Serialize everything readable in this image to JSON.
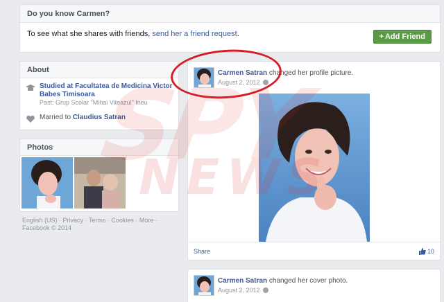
{
  "know_box": {
    "title": "Do you know Carmen?",
    "text": "To see what she shares with friends, ",
    "link": "send her a friend request",
    "text_end": ".",
    "button": "Add Friend",
    "button_icon": "+"
  },
  "about": {
    "title": "About",
    "education": "Studied at Facultatea de Medicina Victor Babes Timisoara",
    "past": "Past: Grup Scolar \"Mihai Viteazul\" Ineu",
    "married_prefix": "Married to ",
    "married_name": "Claudius Satran"
  },
  "photos": {
    "title": "Photos"
  },
  "footer": {
    "links": "English (US) · Privacy · Terms · Cookies · More ·",
    "copyright": "Facebook © 2014"
  },
  "post1": {
    "name": "Carmen Satran",
    "action": "changed her profile picture.",
    "date": "August 2, 2012",
    "share": "Share",
    "likes": "10"
  },
  "post2": {
    "name": "Carmen Satran",
    "action": "changed her cover photo.",
    "date": "August 2, 2012"
  },
  "watermark": {
    "line1": "SPY",
    "line2": "NEWS"
  },
  "colors": {
    "brand": "#3b5998",
    "annotation": "#d41f28",
    "button": "#5b9b47"
  }
}
